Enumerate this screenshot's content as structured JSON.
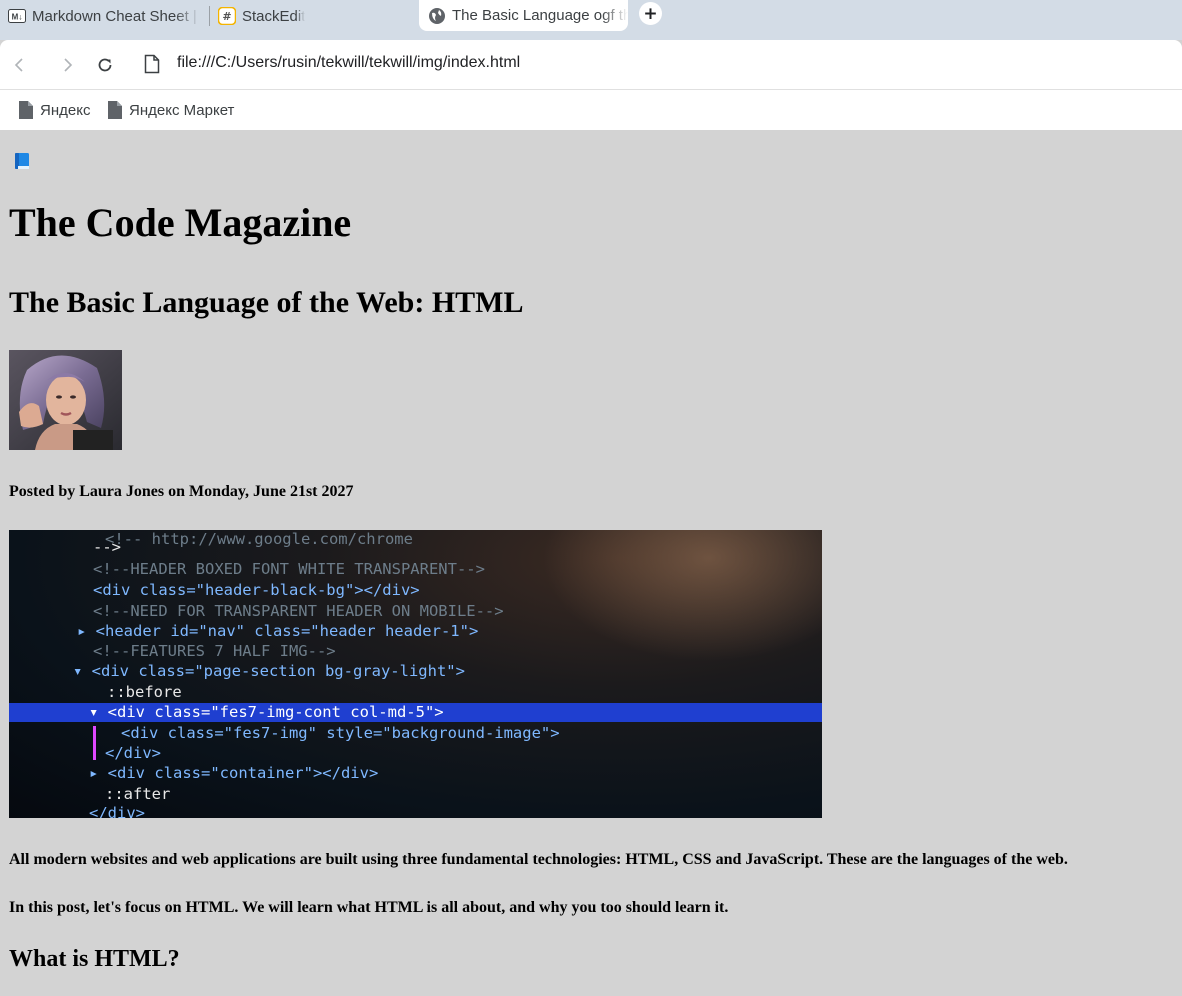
{
  "browser": {
    "tabs": [
      {
        "title": "Markdown Cheat Sheet | I",
        "icon": "markdown-icon"
      },
      {
        "title": "StackEdit",
        "icon": "stackedit-icon"
      },
      {
        "title": "The Basic Language ogf th",
        "icon": "globe-icon",
        "active": true
      }
    ],
    "new_tab_label": "+",
    "address": "file:///C:/Users/rusin/tekwill/tekwill/img/index.html",
    "bookmarks": [
      {
        "label": "Яндекс",
        "icon": "document-icon"
      },
      {
        "label": "Яндекс Маркет",
        "icon": "document-icon"
      }
    ]
  },
  "page": {
    "background": "#d3d3d3",
    "logo_icon": "blue-book-icon",
    "site_title": "The Code Magazine",
    "post_title": "The Basic Language of the Web: HTML",
    "author_image": "author-photo",
    "byline": "Posted by Laura Jones on Monday, June 21st 2027",
    "hero_image": "code-screenshot",
    "paragraphs": [
      "All modern websites and web applications are built using three fundamental technologies: HTML, CSS and JavaScript. These are the languages of the web.",
      "In this post, let's focus on HTML. We will learn what HTML is all about, and why you too should learn it."
    ],
    "section_heading": "What is HTML?"
  },
  "hero_code_lines": [
    "-->",
    "<!--HEADER BOXED FONT WHITE TRANSPARENT-->",
    "<div class=\"header-black-bg\"></div>",
    "<!--NEED FOR TRANSPARENT HEADER ON MOBILE-->",
    "<header id=\"nav\" class=\"header header-1\">",
    "<!--FEATURES 7 HALF IMG-->",
    "<div class=\"page-section bg-gray-light\">",
    "::before",
    "<div class=\"fes7-img-cont col-md-5\">",
    "<div class=\"fes7-img\" style=\"background-image\">",
    "</div>",
    "<div class=\"container\"></div>",
    "::after",
    "</div>"
  ]
}
